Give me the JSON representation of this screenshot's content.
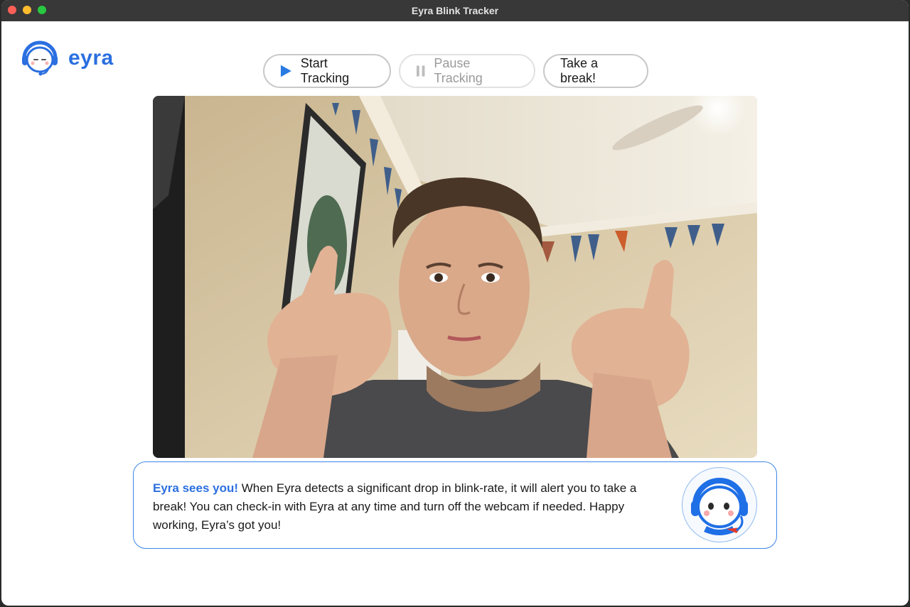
{
  "window": {
    "title": "Eyra Blink Tracker"
  },
  "brand": {
    "name": "eyra",
    "color": "#2b6fe0"
  },
  "toolbar": {
    "start_label": "Start Tracking",
    "pause_label": "Pause Tracking",
    "break_label": "Take a break!",
    "start_icon": "play-icon",
    "pause_icon": "pause-icon"
  },
  "video": {
    "icon": "webcam-feed"
  },
  "info": {
    "headline": "Eyra sees you!",
    "body": " When Eyra detects a significant drop in blink-rate, it will alert you to take a break! You can check-in with Eyra at any time and turn off the webcam if needed. Happy working, Eyra’s got you!",
    "border_color": "#3a86e8"
  },
  "colors": {
    "accent": "#2b6fe0",
    "play": "#2a7ae4",
    "titlebar": "#383838"
  }
}
